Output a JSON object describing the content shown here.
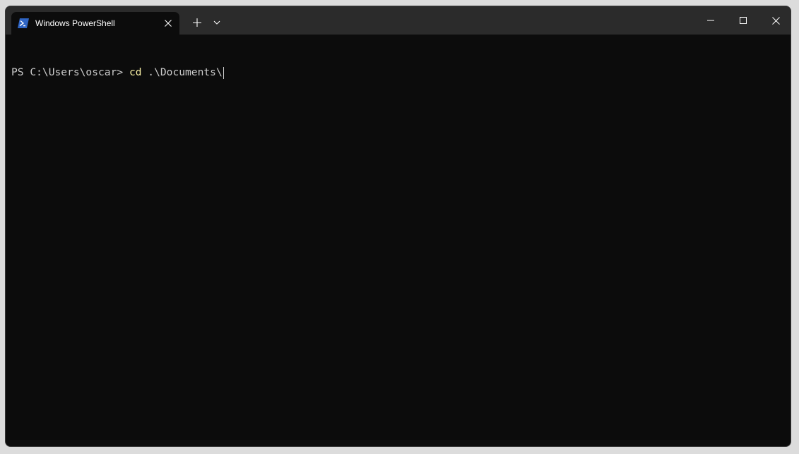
{
  "tabs": [
    {
      "label": "Windows PowerShell",
      "icon": "powershell-icon"
    }
  ],
  "titlebar": {
    "new_tab_icon": "plus-icon",
    "dropdown_icon": "chevron-down-icon",
    "minimize_icon": "minimize-icon",
    "maximize_icon": "maximize-icon",
    "close_icon": "close-icon"
  },
  "terminal": {
    "prompt": "PS C:\\Users\\oscar> ",
    "command": "cd",
    "argument": " .\\Documents\\"
  },
  "colors": {
    "background": "#0c0c0c",
    "titlebar": "#2b2b2b",
    "text": "#cccccc",
    "command": "#f9f1a5",
    "powershell_icon": "#2f65c4"
  }
}
